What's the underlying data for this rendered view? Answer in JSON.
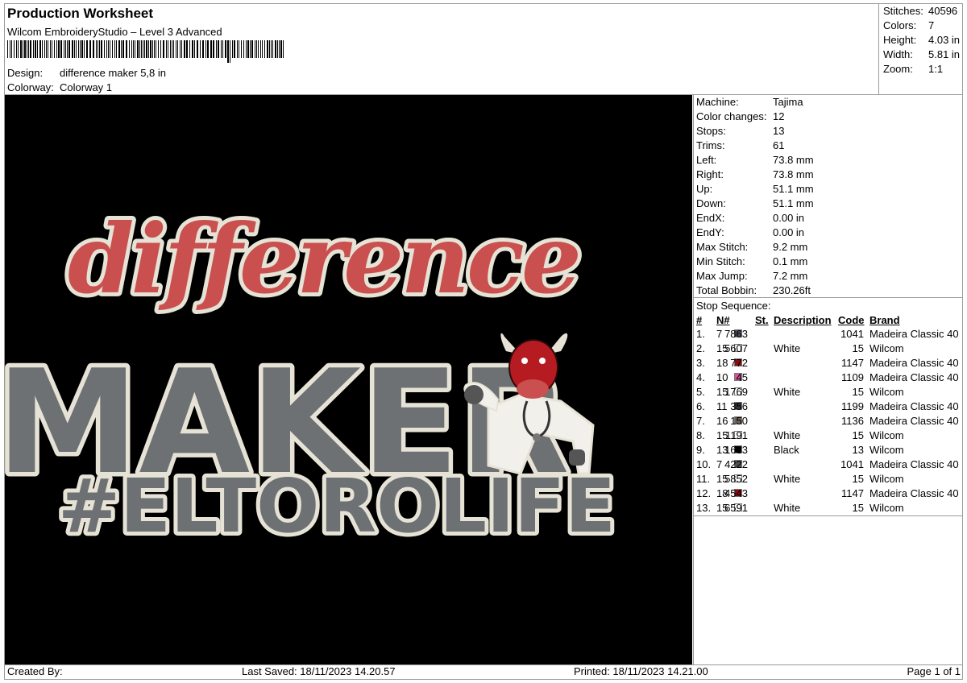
{
  "header": {
    "title": "Production Worksheet",
    "subtitle": "Wilcom EmbroideryStudio – Level 3 Advanced",
    "design_label": "Design:",
    "design_value": "difference maker 5,8 in",
    "colorway_label": "Colorway:",
    "colorway_value": "Colorway 1"
  },
  "stats": [
    {
      "label": "Stitches:",
      "value": "40596"
    },
    {
      "label": "Colors:",
      "value": "7"
    },
    {
      "label": "Height:",
      "value": "4.03 in"
    },
    {
      "label": "Width:",
      "value": "5.81 in"
    },
    {
      "label": "Zoom:",
      "value": "1:1"
    }
  ],
  "machine": [
    {
      "label": "Machine:",
      "value": "Tajima"
    },
    {
      "label": "Color changes:",
      "value": "12"
    },
    {
      "label": "Stops:",
      "value": "13"
    },
    {
      "label": "Trims:",
      "value": "61"
    },
    {
      "label": "Left:",
      "value": "73.8 mm"
    },
    {
      "label": "Right:",
      "value": "73.8 mm"
    },
    {
      "label": "Up:",
      "value": "51.1 mm"
    },
    {
      "label": "Down:",
      "value": "51.1 mm"
    },
    {
      "label": "EndX:",
      "value": "0.00 in"
    },
    {
      "label": "EndY:",
      "value": "0.00 in"
    },
    {
      "label": "Max Stitch:",
      "value": "9.2 mm"
    },
    {
      "label": "Min Stitch:",
      "value": "0.1 mm"
    },
    {
      "label": "Max Jump:",
      "value": "7.2 mm"
    },
    {
      "label": "Total Bobbin:",
      "value": "230.26ft"
    }
  ],
  "stop_sequence": {
    "title": "Stop Sequence:",
    "headers": {
      "num": "#",
      "needle": "N#",
      "stitches": "St.",
      "description": "Description",
      "code": "Code",
      "brand": "Brand"
    },
    "rows": [
      {
        "num": "1.",
        "needle": "7",
        "color": "#4a5158",
        "stitches": "7863",
        "description": "",
        "code": "1041",
        "brand": "Madeira Classic 40"
      },
      {
        "num": "2.",
        "needle": "15",
        "color": "#ffffff",
        "stitches": "5607",
        "description": "White",
        "code": "15",
        "brand": "Wilcom"
      },
      {
        "num": "3.",
        "needle": "18",
        "color": "#8b0c10",
        "stitches": "772",
        "description": "",
        "code": "1147",
        "brand": "Madeira Classic 40"
      },
      {
        "num": "4.",
        "needle": "10",
        "color": "#d9529c",
        "stitches": "45",
        "description": "",
        "code": "1109",
        "brand": "Madeira Classic 40"
      },
      {
        "num": "5.",
        "needle": "15",
        "color": "#ffffff",
        "stitches": "1769",
        "description": "White",
        "code": "15",
        "brand": "Wilcom"
      },
      {
        "num": "6.",
        "needle": "11",
        "color": "#2d3138",
        "stitches": "356",
        "description": "",
        "code": "1199",
        "brand": "Madeira Classic 40"
      },
      {
        "num": "7.",
        "needle": "16",
        "color": "#6b5f57",
        "stitches": "150",
        "description": "",
        "code": "1136",
        "brand": "Madeira Classic 40"
      },
      {
        "num": "8.",
        "needle": "15",
        "color": "#ffffff",
        "stitches": "1191",
        "description": "White",
        "code": "15",
        "brand": "Wilcom"
      },
      {
        "num": "9.",
        "needle": "13",
        "color": "#000000",
        "stitches": "1633",
        "description": "Black",
        "code": "13",
        "brand": "Wilcom"
      },
      {
        "num": "10.",
        "needle": "7",
        "color": "#4a5158",
        "stitches": "4222",
        "description": "",
        "code": "1041",
        "brand": "Madeira Classic 40"
      },
      {
        "num": "11.",
        "needle": "15",
        "color": "#ffffff",
        "stitches": "5852",
        "description": "White",
        "code": "15",
        "brand": "Wilcom"
      },
      {
        "num": "12.",
        "needle": "18",
        "color": "#8b0c10",
        "stitches": "4543",
        "description": "",
        "code": "1147",
        "brand": "Madeira Classic 40"
      },
      {
        "num": "13.",
        "needle": "15",
        "color": "#ffffff",
        "stitches": "6591",
        "description": "White",
        "code": "15",
        "brand": "Wilcom"
      }
    ]
  },
  "design_art": {
    "line1": "difference",
    "line2": "MAKER",
    "line3": "#ELTOROLIFE",
    "colors": {
      "red": "#c9504f",
      "gray": "#6d7174",
      "outline": "#e6e3d6",
      "background": "#000000"
    }
  },
  "footer": {
    "created_by": "Created By:",
    "last_saved": "Last Saved: 18/11/2023 14.20.57",
    "printed": "Printed: 18/11/2023 14.21.00",
    "page": "Page 1 of 1"
  }
}
